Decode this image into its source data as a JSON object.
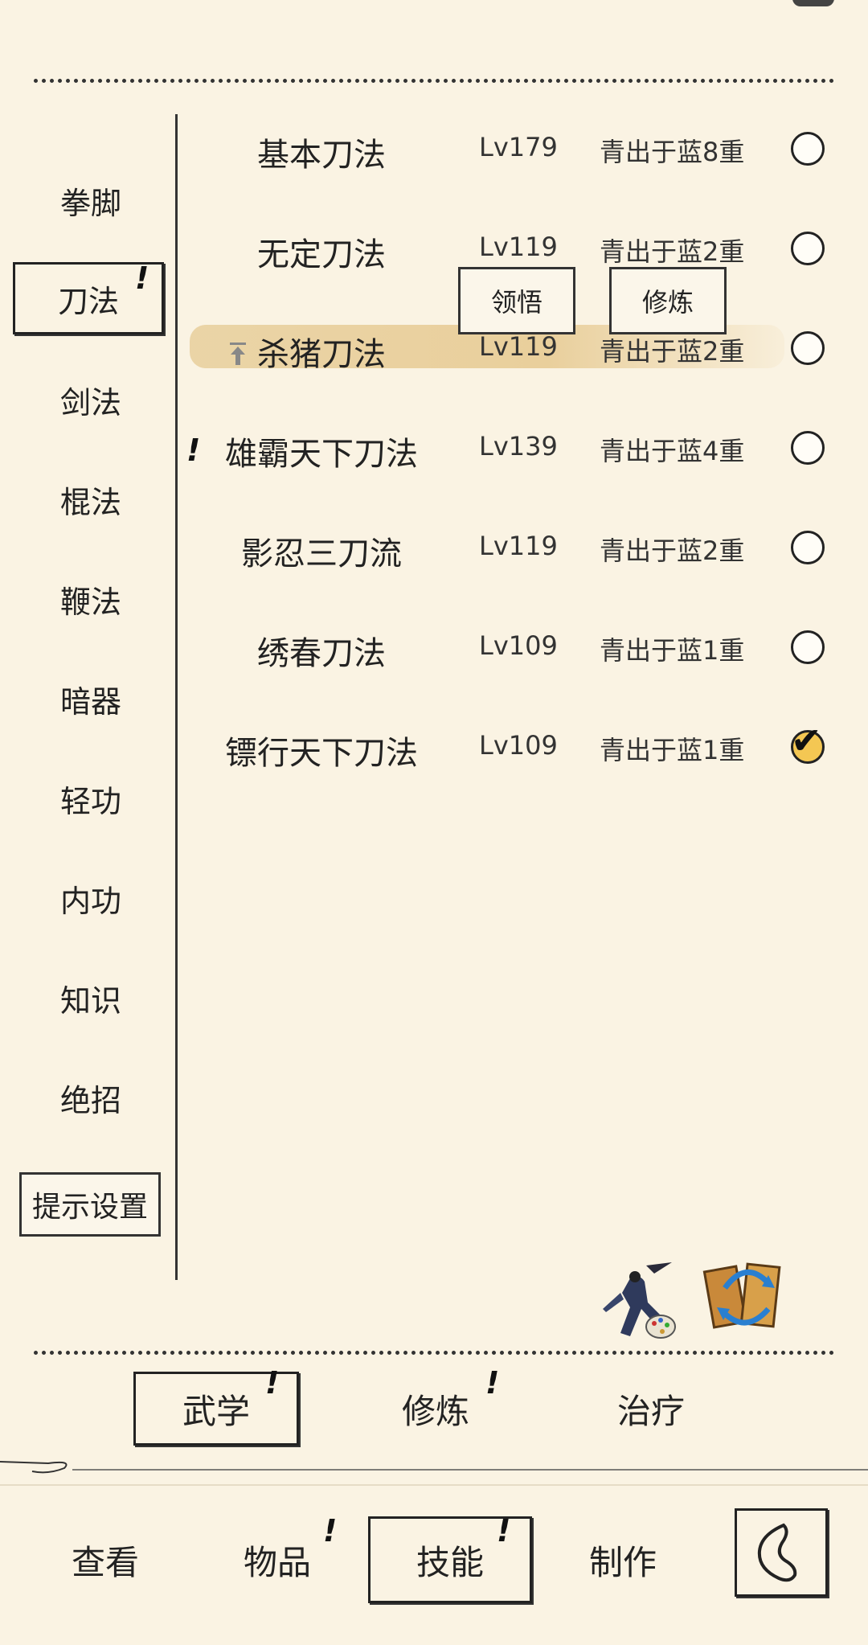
{
  "categories": [
    {
      "label": "拳脚"
    },
    {
      "label": "刀法",
      "selected": true,
      "alert": "!"
    },
    {
      "label": "剑法"
    },
    {
      "label": "棍法"
    },
    {
      "label": "鞭法"
    },
    {
      "label": "暗器"
    },
    {
      "label": "轻功"
    },
    {
      "label": "内功"
    },
    {
      "label": "知识"
    },
    {
      "label": "绝招"
    }
  ],
  "hint_settings_label": "提示设置",
  "skills": [
    {
      "name": "基本刀法",
      "level": "Lv179",
      "rank": "青出于蓝8重",
      "checked": false
    },
    {
      "name": "无定刀法",
      "level": "Lv119",
      "rank": "青出于蓝2重",
      "checked": false
    },
    {
      "name": "杀猪刀法",
      "level": "Lv119",
      "rank": "青出于蓝2重",
      "checked": false,
      "highlighted": true
    },
    {
      "name": "雄霸天下刀法",
      "level": "Lv139",
      "rank": "青出于蓝4重",
      "checked": false,
      "alert": "!"
    },
    {
      "name": "影忍三刀流",
      "level": "Lv119",
      "rank": "青出于蓝2重",
      "checked": false
    },
    {
      "name": "绣春刀法",
      "level": "Lv109",
      "rank": "青出于蓝1重",
      "checked": false
    },
    {
      "name": "镖行天下刀法",
      "level": "Lv109",
      "rank": "青出于蓝1重",
      "checked": true
    }
  ],
  "popup": {
    "comprehend_label": "领悟",
    "train_label": "修炼"
  },
  "sub_tabs": [
    {
      "label": "武学",
      "selected": true,
      "alert": "!"
    },
    {
      "label": "修炼",
      "alert": "!"
    },
    {
      "label": "治疗"
    }
  ],
  "main_tabs": [
    {
      "label": "查看"
    },
    {
      "label": "物品",
      "alert": "!"
    },
    {
      "label": "技能",
      "selected": true,
      "alert": "!"
    },
    {
      "label": "制作"
    }
  ],
  "icons": {
    "swordsman": "swordsman-palette-icon",
    "swap": "book-swap-icon",
    "back": "back-icon"
  },
  "colors": {
    "background": "#faf3e3",
    "ink": "#222222",
    "check_fill": "#f4c753",
    "highlight": "#e8cd98"
  }
}
